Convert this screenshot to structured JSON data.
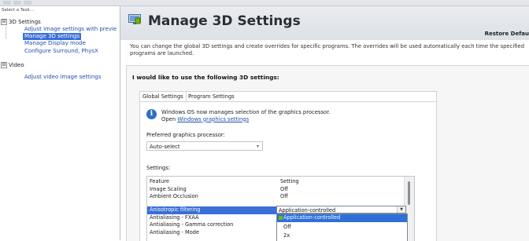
{
  "sidebar": {
    "title": "Select a Task...",
    "items": [
      {
        "label": "3D Settings",
        "type": "group",
        "expander": "⊟"
      },
      {
        "label": "Adjust image settings with previe",
        "type": "link"
      },
      {
        "label": "Manage 3D settings",
        "type": "link",
        "selected": true
      },
      {
        "label": "Manage Display mode",
        "type": "link"
      },
      {
        "label": "Configure Surround, PhysX",
        "type": "link"
      },
      {
        "label": "Video",
        "type": "group",
        "expander": "⊟"
      },
      {
        "label": "Adjust video image settings",
        "type": "link"
      }
    ]
  },
  "header": {
    "title": "Manage 3D Settings",
    "restore_label": "Restore Defau"
  },
  "description": "You can change the global 3D settings and create overrides for specific programs. The overrides will be used automatically each time the specified programs are launched.",
  "section_label": "I would like to use the following 3D settings:",
  "tabs": [
    {
      "label": "Global Settings",
      "active": true
    },
    {
      "label": "Program Settings",
      "active": false
    }
  ],
  "info": {
    "line1": "Windows OS now manages selection of the graphics processor.",
    "line2_prefix": "Open ",
    "link": "Windows graphics settings"
  },
  "preferred_gpu": {
    "label": "Preferred graphics processor:",
    "value": "Auto-select"
  },
  "settings_label": "Settings:",
  "grid": {
    "headers": [
      "Feature",
      "Setting"
    ],
    "rows": [
      {
        "feature": "Image Scaling",
        "setting": "Off"
      },
      {
        "feature": "Ambient Occlusion",
        "setting": "Off"
      },
      {
        "feature": "Anisotropic filtering",
        "setting": "Application-controlled",
        "selected": true
      },
      {
        "feature": "Antialiasing - FXAA",
        "setting": ""
      },
      {
        "feature": "Antialiasing - Gamma correction",
        "setting": ""
      },
      {
        "feature": "Antialiasing - Mode",
        "setting": ""
      }
    ]
  },
  "dropdown_options": [
    {
      "label": "Application-controlled",
      "highlighted": true
    },
    {
      "label": "Off",
      "highlighted": false
    },
    {
      "label": "2x",
      "highlighted": false
    }
  ],
  "colors": {
    "selection": "#3a6fd8",
    "link": "#1f4fb0",
    "nvidia_green": "#76b900"
  }
}
